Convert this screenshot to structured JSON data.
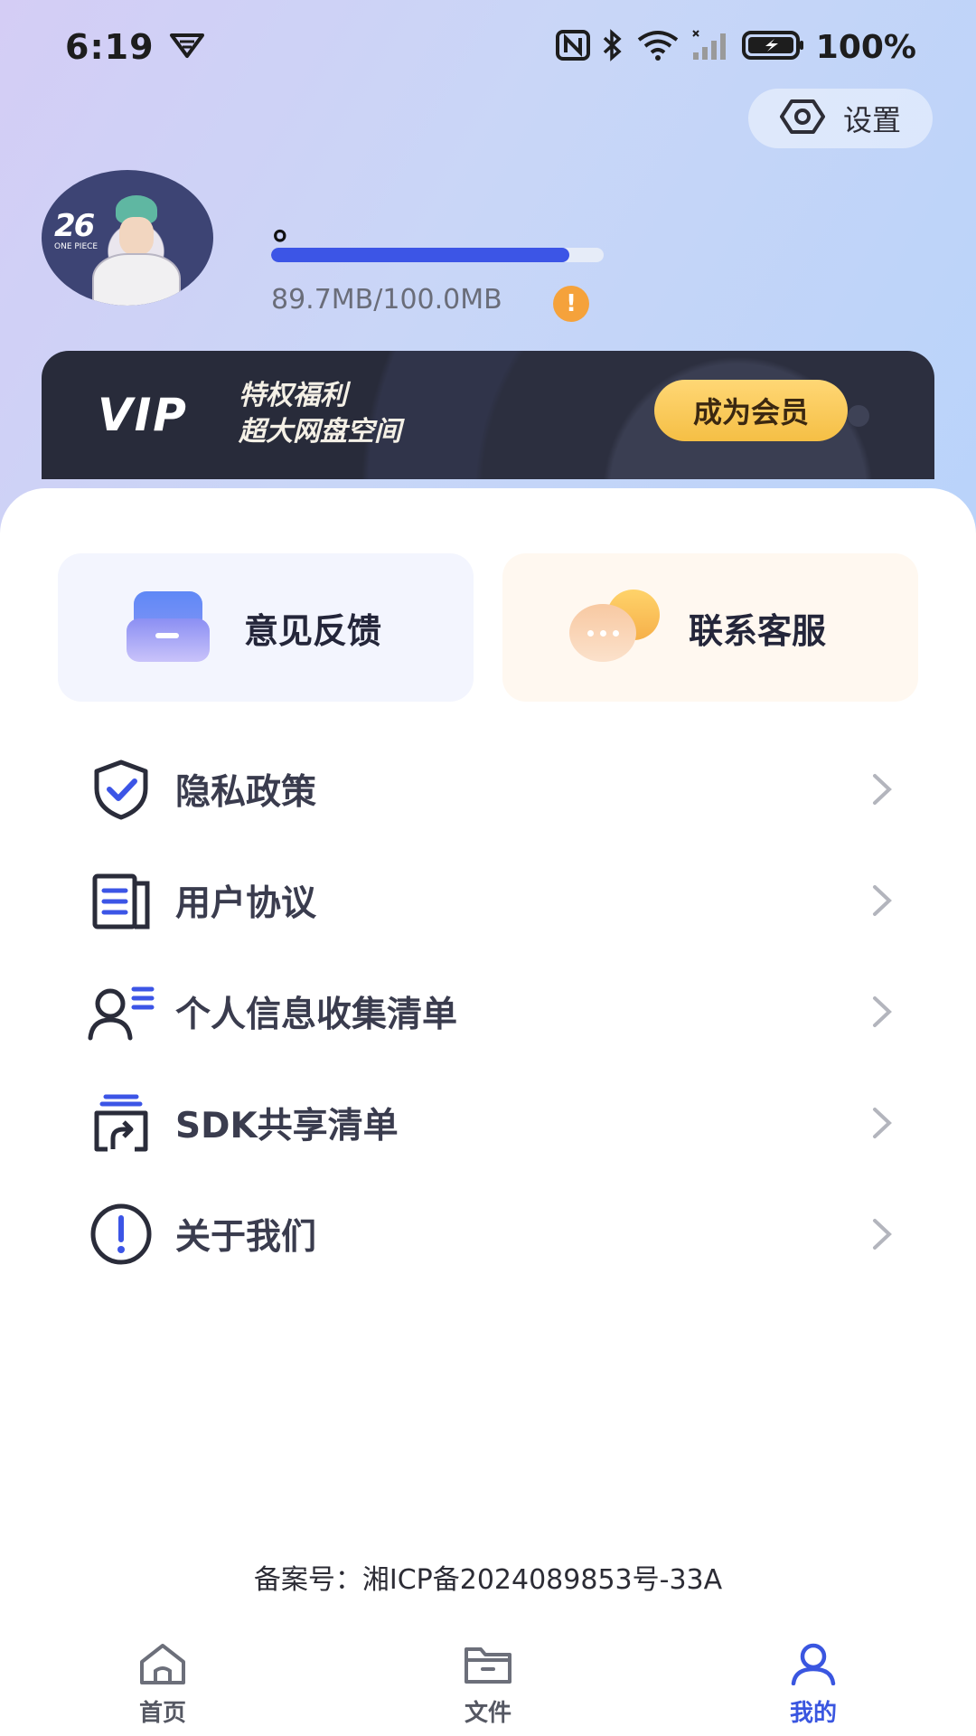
{
  "status_bar": {
    "time": "6:19",
    "battery": "100%"
  },
  "header": {
    "settings_label": "设置"
  },
  "profile": {
    "username": "。",
    "storage_text": "89.7MB/100.0MB",
    "storage_used_fraction": 0.897,
    "avatar_text": "26",
    "avatar_subtext": "ONE PIECE"
  },
  "vip": {
    "logo": "VIP",
    "line1": "特权福利",
    "line2": "超大网盘空间",
    "button_label": "成为会员"
  },
  "quick_actions": {
    "feedback_label": "意见反馈",
    "service_label": "联系客服"
  },
  "menu": {
    "items": [
      {
        "label": "隐私政策",
        "icon": "shield-check-icon"
      },
      {
        "label": "用户协议",
        "icon": "document-icon"
      },
      {
        "label": "个人信息收集清单",
        "icon": "user-list-icon"
      },
      {
        "label": "SDK共享清单",
        "icon": "share-stack-icon"
      },
      {
        "label": "关于我们",
        "icon": "info-icon"
      }
    ]
  },
  "footer": {
    "record": "备案号：湘ICP备2024089853号-33A"
  },
  "bottom_nav": {
    "items": [
      {
        "label": "首页",
        "icon": "home-icon"
      },
      {
        "label": "文件",
        "icon": "folder-icon"
      },
      {
        "label": "我的",
        "icon": "user-icon",
        "active": true
      }
    ]
  },
  "colors": {
    "accent": "#3c55e6",
    "vip_button": "#f5bf45",
    "warning": "#f5a23b"
  }
}
